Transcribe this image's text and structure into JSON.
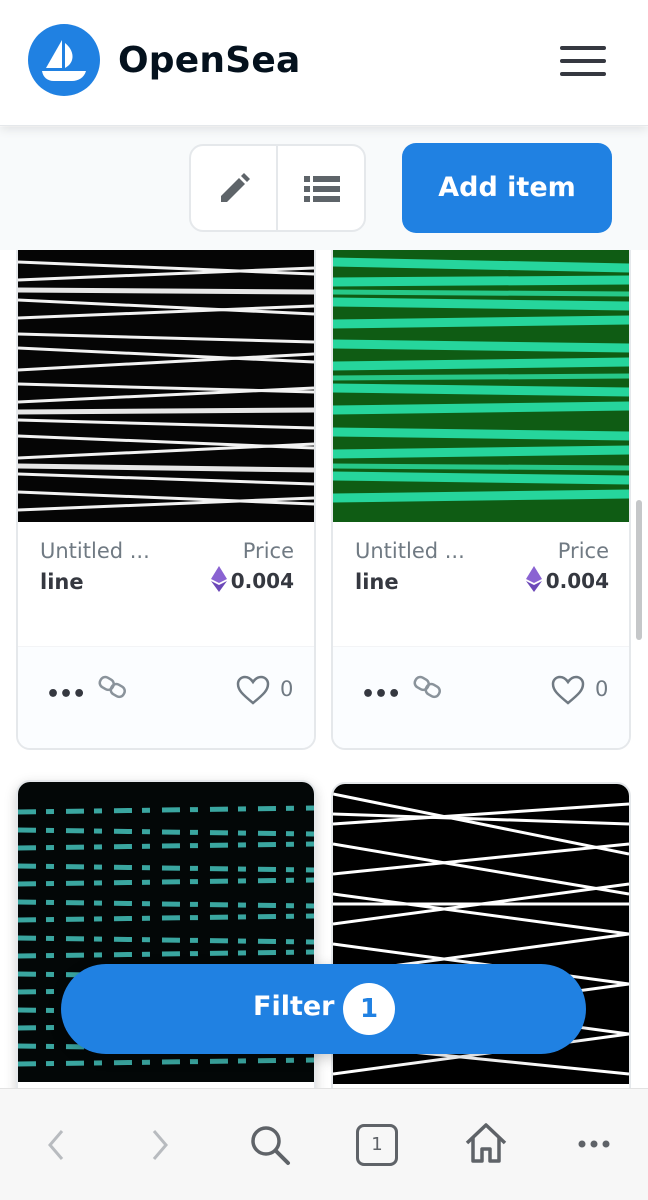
{
  "header": {
    "brand": "OpenSea",
    "logo_icon": "opensea-boat-icon",
    "menu_icon": "hamburger-icon"
  },
  "toolbar": {
    "edit_icon": "pencil-icon",
    "list_icon": "list-view-icon",
    "add_item_label": "Add item"
  },
  "cards": [
    {
      "collection": "Untitled ...",
      "price_label": "Price",
      "name": "line",
      "price": "0.004",
      "likes": "0",
      "art": "white-lines-on-black"
    },
    {
      "collection": "Untitled ...",
      "price_label": "Price",
      "name": "line",
      "price": "0.004",
      "likes": "0",
      "art": "green-lines-on-dark-green"
    },
    {
      "art": "teal-dashes-on-black"
    },
    {
      "art": "white-crossing-lines-on-black"
    }
  ],
  "filter": {
    "label": "Filter",
    "count": "1"
  },
  "browser_bar": {
    "back_icon": "back-arrow-icon",
    "forward_icon": "forward-arrow-icon",
    "search_icon": "search-icon",
    "tabs_count": "1",
    "home_icon": "home-icon",
    "more_icon": "more-icon"
  },
  "colors": {
    "accent": "#2081e2",
    "text": "#04111d",
    "muted": "#707a83",
    "eth": "#8a63d2"
  }
}
